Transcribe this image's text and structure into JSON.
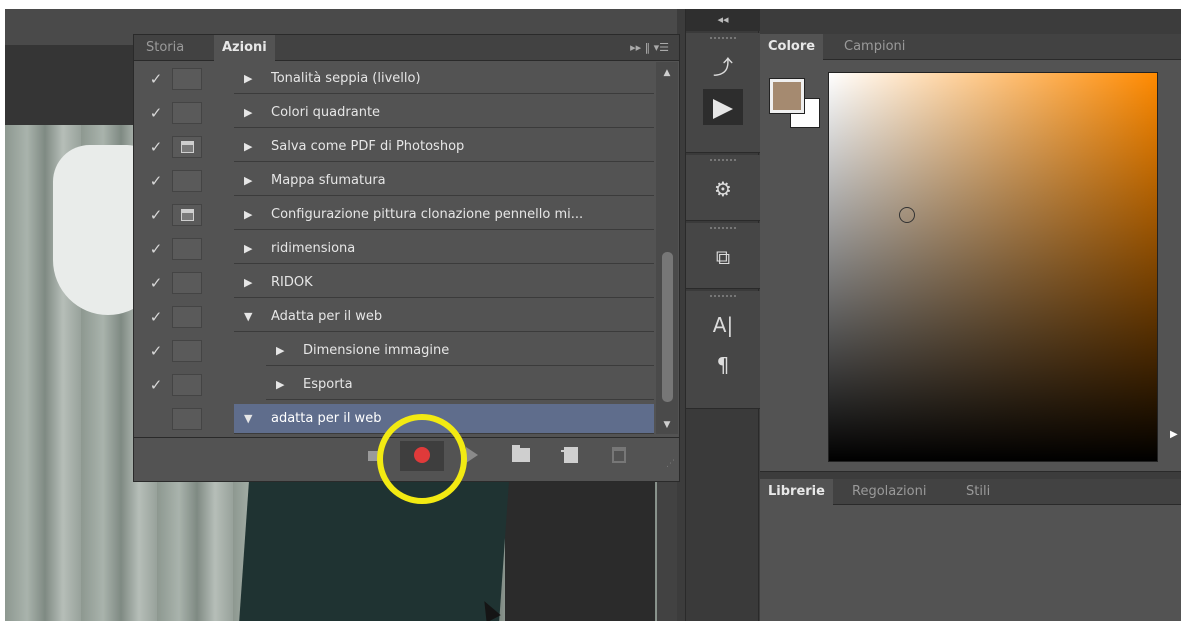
{
  "actions_panel": {
    "tabs": [
      {
        "label": "Storia",
        "active": false
      },
      {
        "label": "Azioni",
        "active": true
      }
    ],
    "tab_tools": "▸▸ ‖ ▾☰",
    "rows": [
      {
        "checked": true,
        "dialog": false,
        "expanded": false,
        "indent": 0,
        "label": "Tonalità seppia (livello)"
      },
      {
        "checked": true,
        "dialog": false,
        "expanded": false,
        "indent": 0,
        "label": "Colori quadrante"
      },
      {
        "checked": true,
        "dialog": true,
        "expanded": false,
        "indent": 0,
        "label": "Salva come PDF di Photoshop"
      },
      {
        "checked": true,
        "dialog": false,
        "expanded": false,
        "indent": 0,
        "label": "Mappa sfumatura"
      },
      {
        "checked": true,
        "dialog": true,
        "expanded": false,
        "indent": 0,
        "label": "Configurazione pittura clonazione pennello mi..."
      },
      {
        "checked": true,
        "dialog": false,
        "expanded": false,
        "indent": 0,
        "label": "ridimensiona"
      },
      {
        "checked": true,
        "dialog": false,
        "expanded": false,
        "indent": 0,
        "label": "RIDOK"
      },
      {
        "checked": true,
        "dialog": false,
        "expanded": true,
        "indent": 0,
        "label": "Adatta per il web"
      },
      {
        "checked": true,
        "dialog": false,
        "expanded": false,
        "indent": 1,
        "label": "Dimensione immagine"
      },
      {
        "checked": true,
        "dialog": false,
        "expanded": false,
        "indent": 1,
        "label": "Esporta"
      },
      {
        "checked": false,
        "dialog": false,
        "expanded": true,
        "indent": 0,
        "label": "adatta per il web",
        "selected": true
      }
    ],
    "footer_buttons": [
      "stop-icon",
      "record-icon",
      "play-icon",
      "folder-icon",
      "new-action-icon",
      "trash-icon"
    ],
    "highlight_color": "#f2ea12",
    "record_color": "#e03a3a",
    "selected_row_color": "#5f6d8c"
  },
  "dock": {
    "collapse_label": "◂◂",
    "icons": [
      {
        "name": "history-icon",
        "glyph": "⤴"
      },
      {
        "name": "actions-play-icon",
        "glyph": "",
        "active": true
      },
      {
        "name": "tool-presets-icon",
        "glyph": "⚙"
      },
      {
        "name": "clone-source-icon",
        "glyph": "⧉"
      },
      {
        "name": "character-icon",
        "glyph": "A|"
      },
      {
        "name": "paragraph-icon",
        "glyph": "¶"
      }
    ]
  },
  "color_panel": {
    "tabs": [
      {
        "label": "Colore",
        "active": true
      },
      {
        "label": "Campioni",
        "active": false
      }
    ],
    "foreground_color": "#a58a70",
    "background_color": "#ffffff",
    "hue_color": "#ff8a00"
  },
  "libraries_panel": {
    "tabs": [
      {
        "label": "Librerie",
        "active": true
      },
      {
        "label": "Regolazioni",
        "active": false
      },
      {
        "label": "Stili",
        "active": false
      }
    ]
  }
}
